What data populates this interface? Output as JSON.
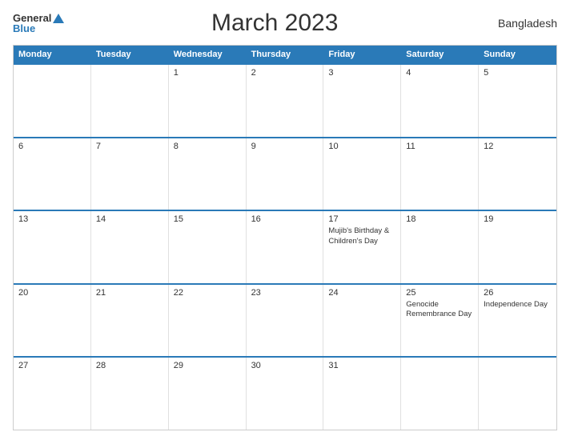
{
  "header": {
    "logo_general": "General",
    "logo_blue": "Blue",
    "title": "March 2023",
    "country": "Bangladesh"
  },
  "calendar": {
    "days": [
      "Monday",
      "Tuesday",
      "Wednesday",
      "Thursday",
      "Friday",
      "Saturday",
      "Sunday"
    ],
    "weeks": [
      [
        {
          "num": "",
          "event": ""
        },
        {
          "num": "",
          "event": ""
        },
        {
          "num": "1",
          "event": ""
        },
        {
          "num": "2",
          "event": ""
        },
        {
          "num": "3",
          "event": ""
        },
        {
          "num": "4",
          "event": ""
        },
        {
          "num": "5",
          "event": ""
        }
      ],
      [
        {
          "num": "6",
          "event": ""
        },
        {
          "num": "7",
          "event": ""
        },
        {
          "num": "8",
          "event": ""
        },
        {
          "num": "9",
          "event": ""
        },
        {
          "num": "10",
          "event": ""
        },
        {
          "num": "11",
          "event": ""
        },
        {
          "num": "12",
          "event": ""
        }
      ],
      [
        {
          "num": "13",
          "event": ""
        },
        {
          "num": "14",
          "event": ""
        },
        {
          "num": "15",
          "event": ""
        },
        {
          "num": "16",
          "event": ""
        },
        {
          "num": "17",
          "event": "Mujib's Birthday & Children's Day"
        },
        {
          "num": "18",
          "event": ""
        },
        {
          "num": "19",
          "event": ""
        }
      ],
      [
        {
          "num": "20",
          "event": ""
        },
        {
          "num": "21",
          "event": ""
        },
        {
          "num": "22",
          "event": ""
        },
        {
          "num": "23",
          "event": ""
        },
        {
          "num": "24",
          "event": ""
        },
        {
          "num": "25",
          "event": "Genocide Remembrance Day"
        },
        {
          "num": "26",
          "event": "Independence Day"
        }
      ],
      [
        {
          "num": "27",
          "event": ""
        },
        {
          "num": "28",
          "event": ""
        },
        {
          "num": "29",
          "event": ""
        },
        {
          "num": "30",
          "event": ""
        },
        {
          "num": "31",
          "event": ""
        },
        {
          "num": "",
          "event": ""
        },
        {
          "num": "",
          "event": ""
        }
      ]
    ]
  }
}
